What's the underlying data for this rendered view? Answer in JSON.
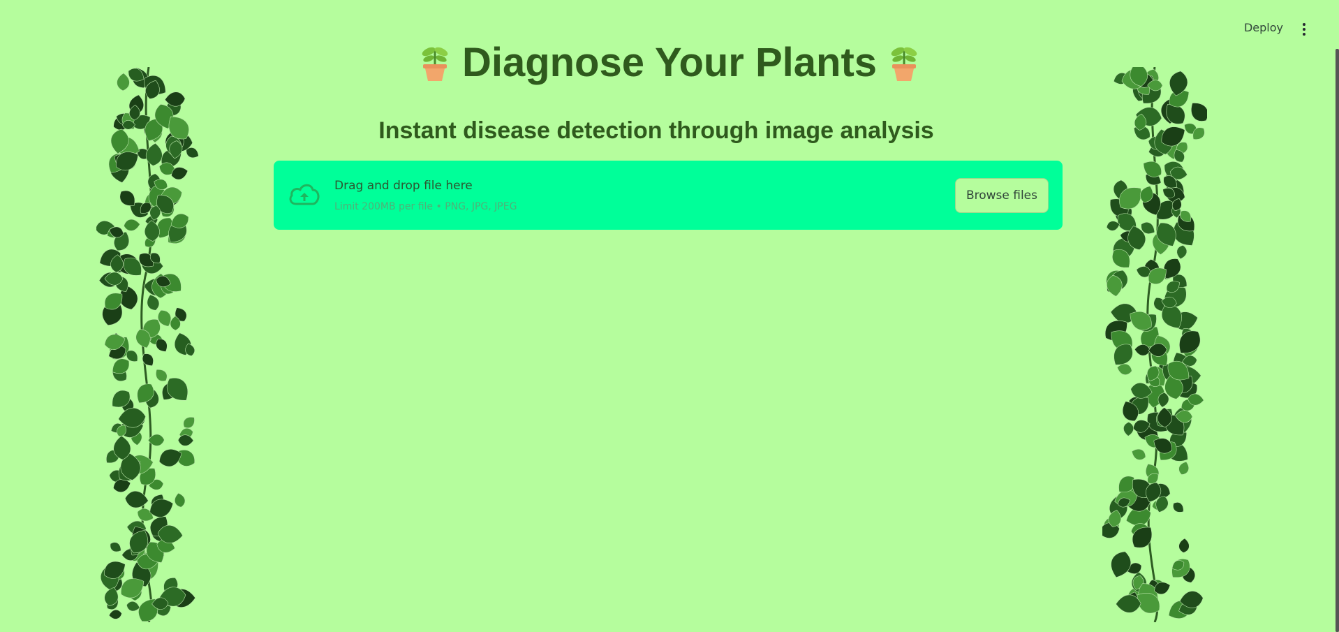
{
  "header": {
    "deploy_label": "Deploy",
    "menu_icon": "vertical-dots-icon"
  },
  "main": {
    "title": "Diagnose Your Plants",
    "title_icon": "potted-plant-icon",
    "subtitle": "Instant disease detection through image analysis"
  },
  "uploader": {
    "drop_text": "Drag and drop file here",
    "limit_text": "Limit 200MB per file • PNG, JPG, JPEG",
    "browse_label": "Browse files",
    "icon": "cloud-upload-icon"
  },
  "decoration": {
    "left_image": "ivy-vine-image",
    "right_image": "ivy-vine-image"
  },
  "colors": {
    "background": "#b5fd9d",
    "title": "#2f5a1d",
    "dropzone": "#00ff99"
  }
}
